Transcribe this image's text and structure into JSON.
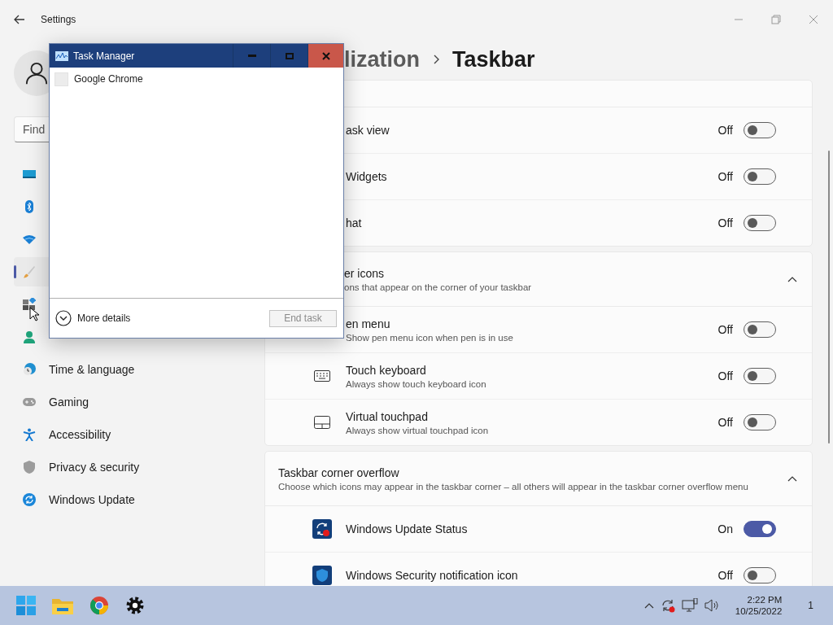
{
  "settings": {
    "title": "Settings",
    "search": {
      "placeholder": "Find"
    },
    "sidebar": [
      {
        "selected": false
      },
      {
        "selected": false
      },
      {
        "selected": false
      },
      {
        "selected": true
      },
      {
        "selected": false
      },
      {
        "selected": false
      },
      {
        "label": "Time & language",
        "selected": false
      },
      {
        "label": "Gaming",
        "selected": false
      },
      {
        "label": "Accessibility",
        "selected": false
      },
      {
        "label": "Privacy & security",
        "selected": false
      },
      {
        "label": "Windows Update",
        "selected": false
      }
    ]
  },
  "breadcrumb": {
    "parent": "lization",
    "current": "Taskbar"
  },
  "sections": [
    {
      "rows": [
        {
          "label": "ask view",
          "state": "Off",
          "on": false
        },
        {
          "label": "Widgets",
          "state": "Off",
          "on": false
        },
        {
          "label": "hat",
          "state": "Off",
          "on": false
        }
      ]
    },
    {
      "title": "er icons",
      "subtitle": "ons that appear on the corner of your taskbar",
      "expanded": true,
      "rows": [
        {
          "label": "en menu",
          "description": "Show pen menu icon when pen is in use",
          "state": "Off",
          "on": false
        },
        {
          "label": "Touch keyboard",
          "description": "Always show touch keyboard icon",
          "state": "Off",
          "on": false
        },
        {
          "label": "Virtual touchpad",
          "description": "Always show virtual touchpad icon",
          "state": "Off",
          "on": false
        }
      ]
    },
    {
      "title": "Taskbar corner overflow",
      "subtitle": "Choose which icons may appear in the taskbar corner – all others will appear in the taskbar corner overflow menu",
      "expanded": true,
      "rows": [
        {
          "label": "Windows Update Status",
          "state": "On",
          "on": true
        },
        {
          "label": "Windows Security notification icon",
          "state": "Off",
          "on": false
        }
      ]
    }
  ],
  "task_manager": {
    "title": "Task Manager",
    "apps": [
      {
        "name": "Google Chrome"
      }
    ],
    "more_details": "More details",
    "end_task": {
      "label": "End task",
      "disabled": true
    }
  },
  "taskbar": {
    "time": "2:22 PM",
    "date": "10/25/2022",
    "notifications": "1"
  }
}
